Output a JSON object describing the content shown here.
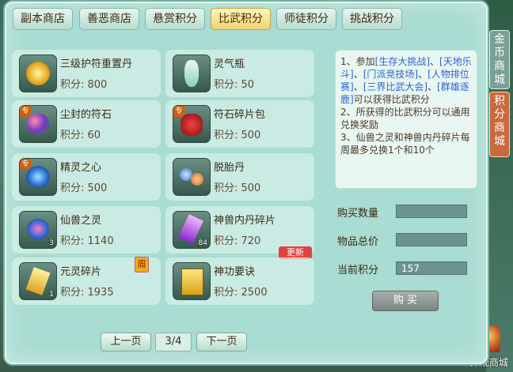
{
  "tabs": [
    {
      "label": "副本商店"
    },
    {
      "label": "善恶商店"
    },
    {
      "label": "悬赏积分"
    },
    {
      "label": "比武积分",
      "active": true
    },
    {
      "label": "师徒积分"
    },
    {
      "label": "挑战积分"
    }
  ],
  "items": [
    {
      "name": "三级护符重置丹",
      "price": "积分: 800"
    },
    {
      "name": "灵气瓶",
      "price": "积分: 50"
    },
    {
      "name": "尘封的符石",
      "price": "积分: 60",
      "tag": "专"
    },
    {
      "name": "符石碎片包",
      "price": "积分: 500",
      "tag": "专"
    },
    {
      "name": "精灵之心",
      "price": "积分: 500",
      "tag": "专"
    },
    {
      "name": "脱胎丹",
      "price": "积分: 500"
    },
    {
      "name": "仙兽之灵",
      "price": "积分: 1140",
      "qty": "3"
    },
    {
      "name": "神兽内丹碎片",
      "price": "积分: 720",
      "qty": "84",
      "ribbon": "更新"
    },
    {
      "name": "元灵碎片",
      "price": "积分: 1935",
      "qty": "1",
      "week": "周"
    },
    {
      "name": "神功要诀",
      "price": "积分: 2500"
    }
  ],
  "description": {
    "p1": "1、参加",
    "h1": "[生存大挑战]",
    "s1": "、",
    "h2": "[天地乐斗]",
    "s2": "、",
    "h3": "[门派竞技场]",
    "s3": "、",
    "h4": "[人物排位赛]",
    "s4": "、",
    "h5": "[三界比武大会]",
    "s5": "、",
    "h6": "[群雄逐鹿]",
    "p1end": "可以获得比武积分",
    "p2": "2、所获得的比武积分可以通用兑换奖励",
    "p3": "3、仙兽之灵和神兽内丹碎片每周最多兑换1个和10个"
  },
  "form": {
    "qty_label": "购买数量",
    "qty_value": "",
    "total_label": "物品总价",
    "total_value": "",
    "current_label": "当前积分",
    "current_value": "157",
    "buy_label": "购 买"
  },
  "pager": {
    "prev": "上一页",
    "page": "3/4",
    "next": "下一页"
  },
  "side": {
    "gold_shop": "金币商城",
    "points_shop": "积分商城",
    "appearance_shop": "外观商城"
  },
  "colors": {
    "active_tab": "#f2d36d",
    "highlight_text": "#2b63d6",
    "ribbon": "#e3413d"
  }
}
